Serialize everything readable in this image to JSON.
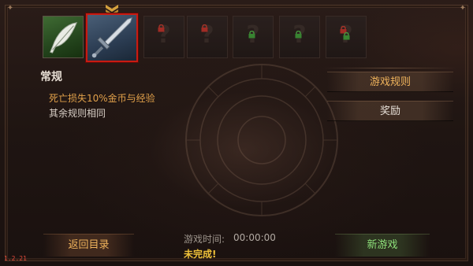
{
  "levels": [
    {
      "icon": "feather-icon",
      "state": "unlocked",
      "color": "#3f6b33"
    },
    {
      "icon": "sword-icon",
      "state": "selected",
      "color": "#c81b12"
    },
    {
      "icon": "question-icon",
      "state": "locked",
      "lock_color": "red"
    },
    {
      "icon": "question-icon",
      "state": "locked",
      "lock_color": "red"
    },
    {
      "icon": "question-icon",
      "state": "locked",
      "lock_color": "green"
    },
    {
      "icon": "question-icon",
      "state": "locked",
      "lock_color": "green"
    },
    {
      "icon": "question-icon",
      "state": "locked",
      "lock_color": "red-green"
    }
  ],
  "level_placeholder_glyph": "?",
  "mode": {
    "title": "常规",
    "rules": [
      "死亡损失10%金币与经验",
      "其余规则相同"
    ]
  },
  "side_buttons": {
    "rules": "游戏规则",
    "rewards": "奖励"
  },
  "footer": {
    "back": "返回目录",
    "time_label": "游戏时间:",
    "time_value": "00:00:00",
    "status": "未完成!",
    "new_game": "新游戏"
  },
  "version": "1.2.21",
  "colors": {
    "accent_gold": "#f0b45c",
    "selected_border": "#c81b12",
    "new_game_green": "#8ee07a",
    "status_yellow": "#f0c23a",
    "version_red": "#e0493a"
  }
}
